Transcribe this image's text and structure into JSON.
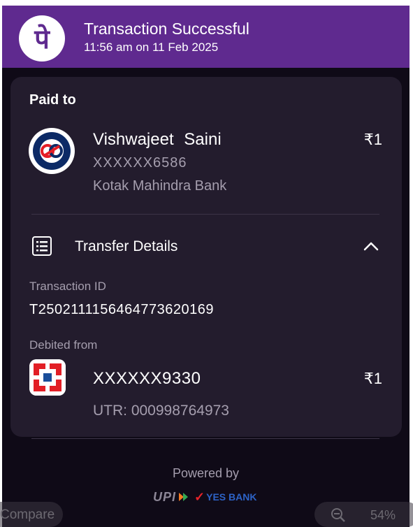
{
  "header": {
    "title": "Transaction Successful",
    "subtitle": "11:56 am on 11 Feb 2025",
    "logo_glyph": "पे"
  },
  "paid_to": {
    "label": "Paid to",
    "name": "Vishwajeet  Saini",
    "account": "XXXXXX6586",
    "bank": "Kotak Mahindra Bank",
    "amount": "₹1"
  },
  "transfer_details": {
    "title": "Transfer Details",
    "transaction_id_label": "Transaction ID",
    "transaction_id": "T2502111156464773620169",
    "debited_from_label": "Debited from",
    "debit_account": "XXXXXX9330",
    "debit_amount": "₹1",
    "utr": "UTR: 000998764973"
  },
  "footer": {
    "powered_by": "Powered by",
    "upi_label": "UPI",
    "yes_bank_label": "YES BANK"
  },
  "overlay": {
    "compare_label": "Compare",
    "zoom_level": "54%"
  },
  "colors": {
    "header_purple": "#5f2a8f",
    "card_bg": "#231c2d",
    "page_bg": "#0f0a17",
    "muted_text": "#a59eae"
  }
}
